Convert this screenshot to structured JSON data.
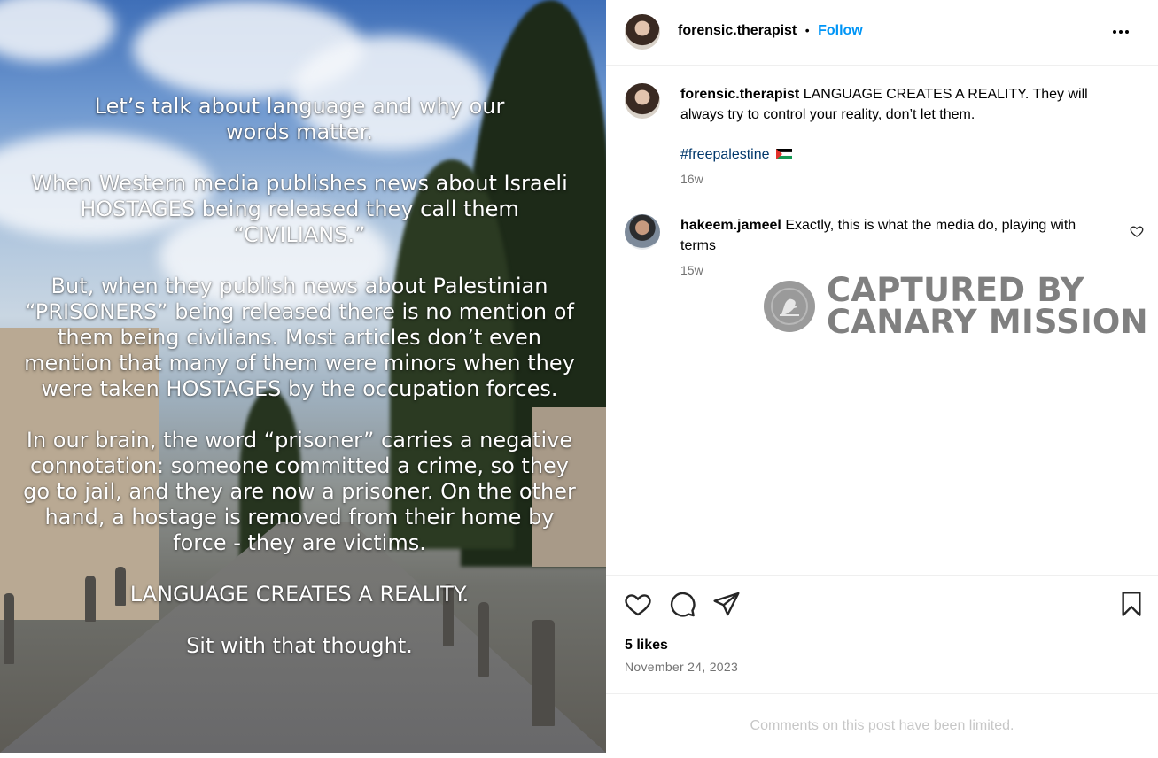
{
  "post_image": {
    "overlay_paragraphs": [
      "Let’s talk about language and why our words matter.",
      "When Western media publishes news about Israeli HOSTAGES being released they call them “CIVILIANS.”",
      "But, when they publish news about Palestinian “PRISONERS” being released there is no mention of them being civilians. Most articles don’t even mention that many of them were minors when they were taken HOSTAGES by the occupation forces.",
      "In our brain, the word “prisoner” carries a negative connotation: someone committed a crime, so they go to jail, and they are now a prisoner. On the other hand, a hostage is removed from their home by force - they are victims.",
      "LANGUAGE CREATES A REALITY.",
      "Sit with that thought."
    ]
  },
  "header": {
    "username": "forensic.therapist",
    "separator": "•",
    "follow_label": "Follow",
    "more_icon": "more-horizontal-icon"
  },
  "caption": {
    "username": "forensic.therapist",
    "text": "LANGUAGE CREATES A REALITY. They will always try to control your reality, don’t let them.",
    "hashtag": "#freepalestine",
    "flag_icon": "palestine-flag-icon",
    "age": "16w"
  },
  "comments": [
    {
      "username": "hakeem.jameel",
      "text": "Exactly, this is what the media do, playing with terms",
      "age": "15w",
      "like_icon": "heart-icon"
    }
  ],
  "watermark": {
    "line1": "CAPTURED BY",
    "line2": "CANARY MISSION",
    "icon": "canary-bird-icon"
  },
  "actions": {
    "like_icon": "heart-icon",
    "comment_icon": "comment-icon",
    "share_icon": "send-icon",
    "save_icon": "bookmark-icon",
    "likes": "5 likes",
    "date": "November 24, 2023"
  },
  "footer": {
    "limited_text": "Comments on this post have been limited."
  },
  "colors": {
    "link_blue": "#0095f6",
    "hashtag_blue": "#00376b",
    "secondary_text": "#737373",
    "divider": "#efefef"
  }
}
